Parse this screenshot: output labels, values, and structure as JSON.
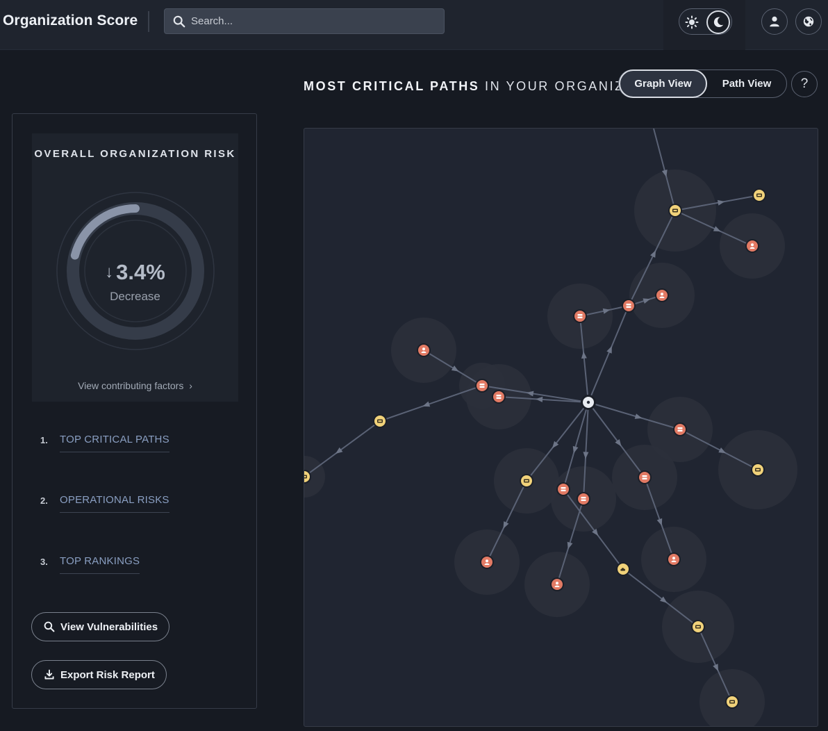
{
  "header": {
    "app_title": "Organization Score",
    "search_placeholder": "Search..."
  },
  "risk_card": {
    "title": "OVERALL ORGANIZATION RISK",
    "change_value": "3.4%",
    "change_direction": "down",
    "change_label": "Decrease",
    "gauge_fill_fraction": 0.21,
    "view_factors_link": "View contributing factors"
  },
  "nav": [
    {
      "number": "1.",
      "label": "TOP CRITICAL PATHS"
    },
    {
      "number": "2.",
      "label": "OPERATIONAL RISKS"
    },
    {
      "number": "3.",
      "label": "TOP RANKINGS"
    }
  ],
  "actions": {
    "view_vulnerabilities": "View Vulnerabilities",
    "export_report": "Export Risk Report"
  },
  "main": {
    "title_bold": "MOST CRITICAL PATHS",
    "title_rest": " IN YOUR ORGANIZATION",
    "view_tabs": [
      {
        "label": "Graph View",
        "active": true
      },
      {
        "label": "Path View",
        "active": false
      }
    ],
    "help_label": "?"
  },
  "colors": {
    "accent_orange": "#e27a64",
    "accent_yellow": "#f1d27a",
    "center_node": "#e9ecf1",
    "edge": "#5a6275",
    "link_blue": "#8a9fc2"
  }
}
